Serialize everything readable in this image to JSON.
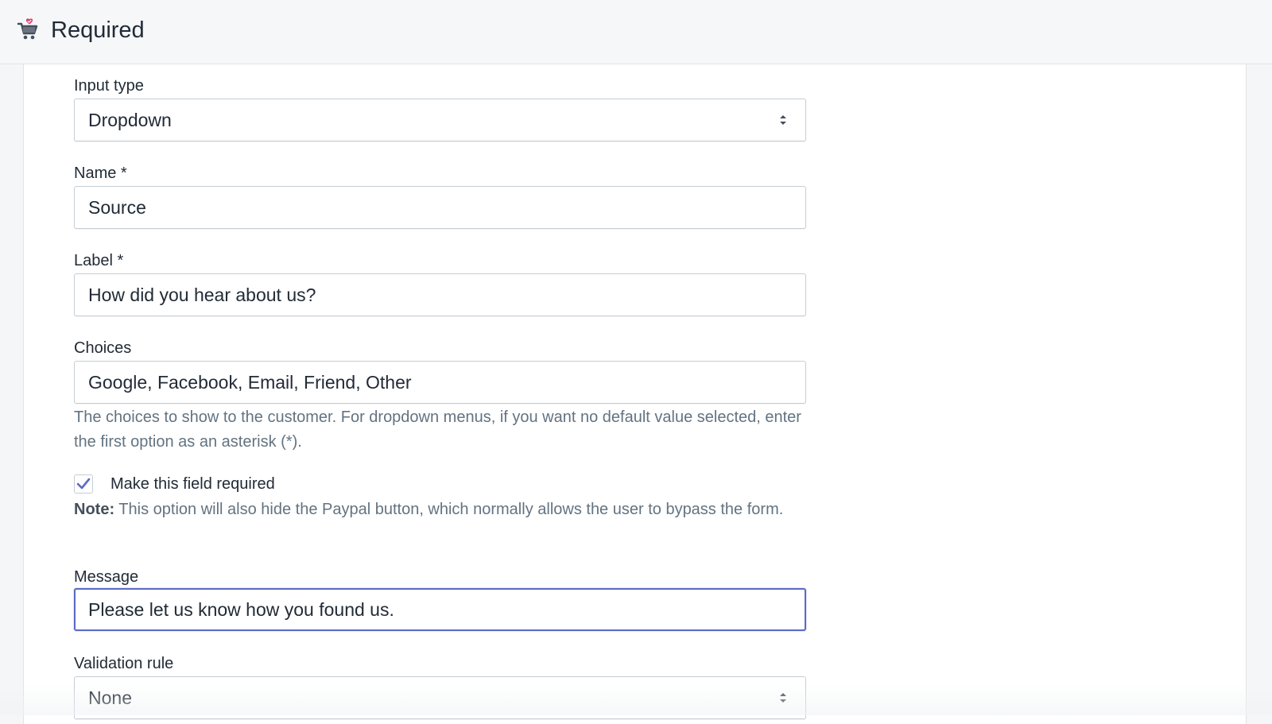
{
  "header": {
    "title": "Required",
    "icon": "shopping-cart-heart-icon"
  },
  "form": {
    "input_type": {
      "label": "Input type",
      "value": "Dropdown"
    },
    "name": {
      "label": "Name *",
      "value": "Source"
    },
    "label_field": {
      "label": "Label *",
      "value": "How did you hear about us?"
    },
    "choices": {
      "label": "Choices",
      "value": "Google, Facebook, Email, Friend, Other",
      "help": "The choices to show to the customer. For dropdown menus, if you want no default value selected, enter the first option as an asterisk (*)."
    },
    "required": {
      "label": "Make this field required",
      "checked": true,
      "note_prefix": "Note:",
      "note": " This option will also hide the Paypal button, which normally allows the user to bypass the form."
    },
    "message": {
      "label": "Message",
      "value": "Please let us know how you found us."
    },
    "validation_rule": {
      "label": "Validation rule",
      "value": "None"
    }
  },
  "colors": {
    "accent": "#5c6ac4",
    "cart_red": "#e3356b",
    "text": "#212b36",
    "subdued": "#637381"
  }
}
